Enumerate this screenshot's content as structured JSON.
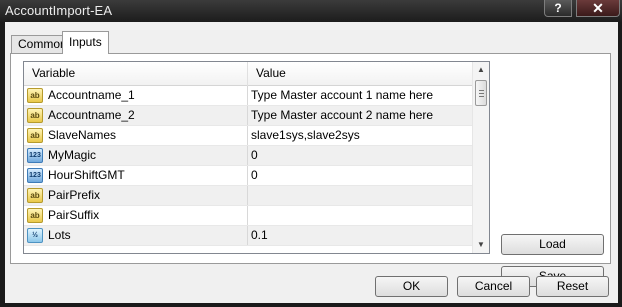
{
  "window": {
    "title": "AccountImport-EA",
    "help_glyph": "?",
    "close_glyph": "✕"
  },
  "tabs": [
    {
      "label": "Common",
      "active": false
    },
    {
      "label": "Inputs",
      "active": true
    }
  ],
  "table": {
    "headers": {
      "variable": "Variable",
      "value": "Value"
    },
    "rows": [
      {
        "icon": "string-type-icon",
        "icon_text": "ab",
        "name": "Accountname_1",
        "value": "Type Master account 1 name here"
      },
      {
        "icon": "string-type-icon",
        "icon_text": "ab",
        "name": "Accountname_2",
        "value": "Type Master account 2 name here"
      },
      {
        "icon": "string-type-icon",
        "icon_text": "ab",
        "name": "SlaveNames",
        "value": "slave1sys,slave2sys"
      },
      {
        "icon": "integer-type-icon",
        "icon_text": "123",
        "name": "MyMagic",
        "value": "0"
      },
      {
        "icon": "integer-type-icon",
        "icon_text": "123",
        "name": "HourShiftGMT",
        "value": "0"
      },
      {
        "icon": "string-type-icon",
        "icon_text": "ab",
        "name": "PairPrefix",
        "value": ""
      },
      {
        "icon": "string-type-icon",
        "icon_text": "ab",
        "name": "PairSuffix",
        "value": ""
      },
      {
        "icon": "double-type-icon",
        "icon_text": "½",
        "name": "Lots",
        "value": "0.1"
      }
    ]
  },
  "buttons": {
    "load": "Load",
    "save": "Save",
    "ok": "OK",
    "cancel": "Cancel",
    "reset": "Reset"
  },
  "scrollbar": {
    "up_glyph": "▲",
    "down_glyph": "▼"
  }
}
